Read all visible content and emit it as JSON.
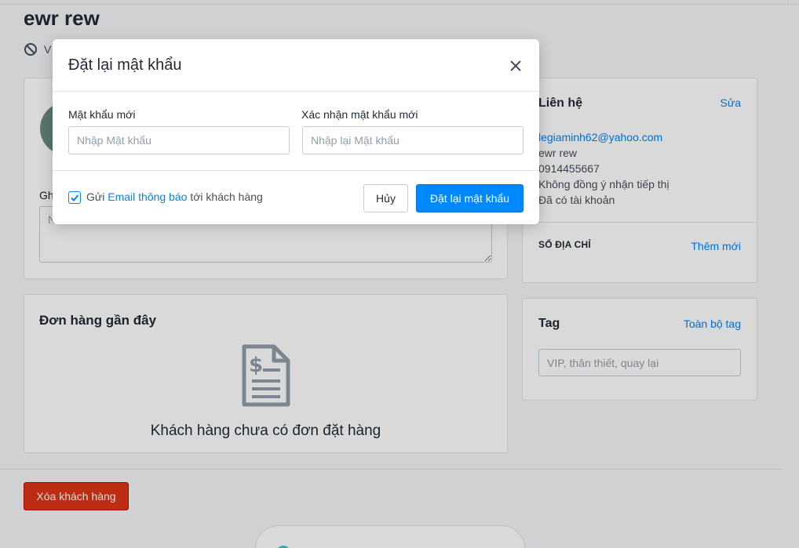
{
  "customer": {
    "name": "ewr rew",
    "status_text": "V"
  },
  "note": {
    "label": "Gh",
    "placeholder": "N"
  },
  "orders": {
    "title": "Đơn hàng gần đây",
    "icon": "invoice-dollar-icon",
    "empty_text": "Khách hàng chưa có đơn đặt hàng"
  },
  "contact": {
    "title": "Liên hệ",
    "edit_label": "Sửa",
    "email": "legiaminh62@yahoo.com",
    "name": "ewr rew",
    "phone": "0914455667",
    "marketing": "Không đồng ý nhận tiếp thị",
    "account_status": "Đã có tài khoản",
    "address_title": "SỔ ĐỊA CHỈ",
    "add_label": "Thêm mới"
  },
  "tags": {
    "title": "Tag",
    "all_label": "Toàn bộ tag",
    "placeholder": "VIP, thân thiết, quay lại"
  },
  "footer": {
    "delete_label": "Xóa khách hàng"
  },
  "modal": {
    "title": "Đặt lại mật khẩu",
    "new_password_label": "Mật khẩu mới",
    "new_password_placeholder": "Nhập Mật khẩu",
    "confirm_password_label": "Xác nhận mật khẩu mới",
    "confirm_password_placeholder": "Nhập lại Mật khẩu",
    "notify_checked": true,
    "notify_prefix": "Gửi ",
    "notify_link": "Email thông báo",
    "notify_suffix": " tới khách hàng",
    "cancel_label": "Hủy",
    "submit_label": "Đặt lại mật khẩu"
  },
  "colors": {
    "accent": "#0084ff",
    "danger": "#de3618"
  }
}
